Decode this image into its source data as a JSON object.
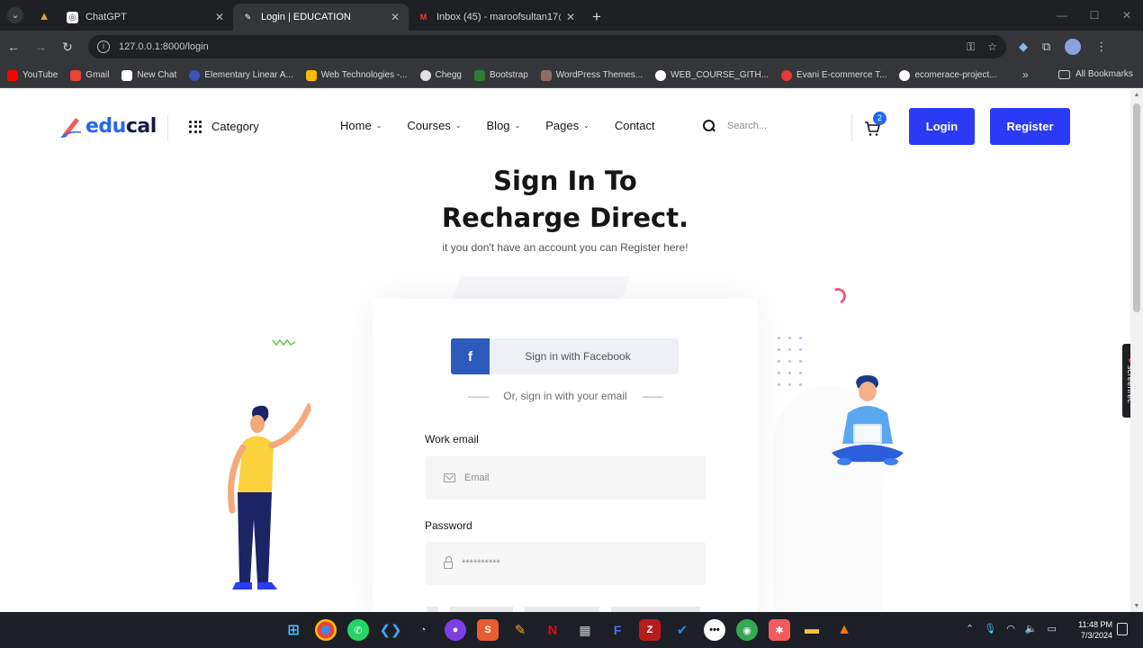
{
  "browser": {
    "tabs": [
      {
        "title": "ChatGPT",
        "active": false
      },
      {
        "title": "Login | EDUCATION",
        "active": true
      },
      {
        "title": "Inbox (45) - maroofsultan17@...",
        "active": false
      }
    ],
    "url": "127.0.0.1:8000/login",
    "bookmarks": [
      {
        "label": "YouTube",
        "color": "#ff0000"
      },
      {
        "label": "Gmail",
        "color": "#ea4335"
      },
      {
        "label": "New Chat",
        "color": "#ffffff"
      },
      {
        "label": "Elementary Linear A...",
        "color": "#3f51b5"
      },
      {
        "label": "Web Technologies -...",
        "color": "#fbbc04"
      },
      {
        "label": "Chegg",
        "color": "#e0e0e0"
      },
      {
        "label": "Bootstrap",
        "color": "#2e7d32"
      },
      {
        "label": "WordPress Themes...",
        "color": "#8d6e63"
      },
      {
        "label": "WEB_COURSE_GITH...",
        "color": "#ffffff"
      },
      {
        "label": "Evani E-commerce T...",
        "color": "#e53935"
      },
      {
        "label": "ecomerace-project...",
        "color": "#ffffff"
      }
    ],
    "all_bookmarks": "All Bookmarks"
  },
  "site": {
    "logo": {
      "part1": "edu",
      "part2": "cal"
    },
    "category": "Category",
    "nav": [
      {
        "label": "Home",
        "dropdown": true
      },
      {
        "label": "Courses",
        "dropdown": true
      },
      {
        "label": "Blog",
        "dropdown": true
      },
      {
        "label": "Pages",
        "dropdown": true
      },
      {
        "label": "Contact",
        "dropdown": false
      }
    ],
    "search_placeholder": "Search...",
    "cart_count": "2",
    "login_label": "Login",
    "register_label": "Register",
    "accent": "#2b3bf5"
  },
  "hero": {
    "title_line1": "Sign In To",
    "title_line2": "Recharge Direct.",
    "subtitle": "it you don't have an account you can Register here!"
  },
  "form": {
    "facebook_label": "Sign in with Facebook",
    "facebook_icon": "f",
    "or_text": "Or, sign in with your email",
    "email_label": "Work email",
    "email_placeholder": "Email",
    "password_label": "Password",
    "password_value": "**********"
  },
  "overlay": {
    "screenrec": "screenrec"
  },
  "taskbar": {
    "time": "11:48 PM",
    "date": "7/3/2024"
  }
}
